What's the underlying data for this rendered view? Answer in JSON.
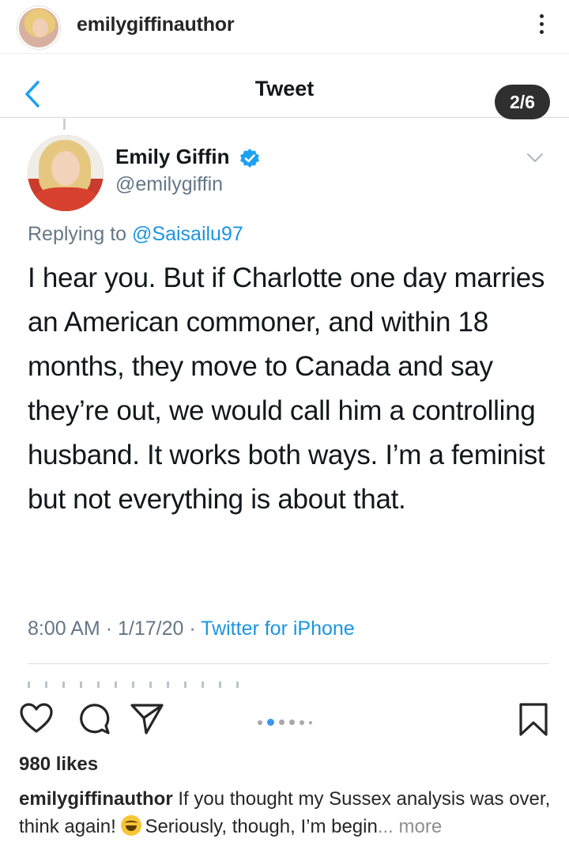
{
  "post_header": {
    "username": "emilygiffinauthor",
    "avatar_icon": "profile-photo",
    "more_icon": "more-options-icon"
  },
  "tweet_view": {
    "title": "Tweet",
    "back_icon": "back-chevron-icon",
    "slide_indicator": "2/6",
    "author_name": "Emily Giffin",
    "verified_icon": "verified-badge-icon",
    "handle": "@emilygiffin",
    "replying_prefix": "Replying to",
    "replying_to": "@Saisailu97",
    "body": "I hear you. But if Charlotte one day marries an American commoner, and within 18 months, they move to Canada and say they’re out, we would call him a controlling husband. It works both ways. I’m a feminist but not everything is about that.",
    "time": "8:00 AM",
    "date": "1/17/20",
    "source": "Twitter for iPhone",
    "separator": "·"
  },
  "actions": {
    "like_icon": "heart-icon",
    "comment_icon": "comment-icon",
    "share_icon": "paper-plane-icon",
    "save_icon": "bookmark-icon",
    "carousel_total": 6,
    "carousel_active": 2
  },
  "likes": "980 likes",
  "caption": {
    "username": "emilygiffinauthor",
    "text_before_emoji": "If you thought my Sussex analysis was over, think again!",
    "emoji": "grinning-sweat-face",
    "text_after_emoji": "Seriously, though, I’m begin",
    "ellipsis": "...",
    "more_label": "more"
  },
  "colors": {
    "link_blue": "#1b95e0",
    "ig_blue": "#3897f0",
    "meta_gray": "#657786",
    "text_dark": "#14171a"
  }
}
